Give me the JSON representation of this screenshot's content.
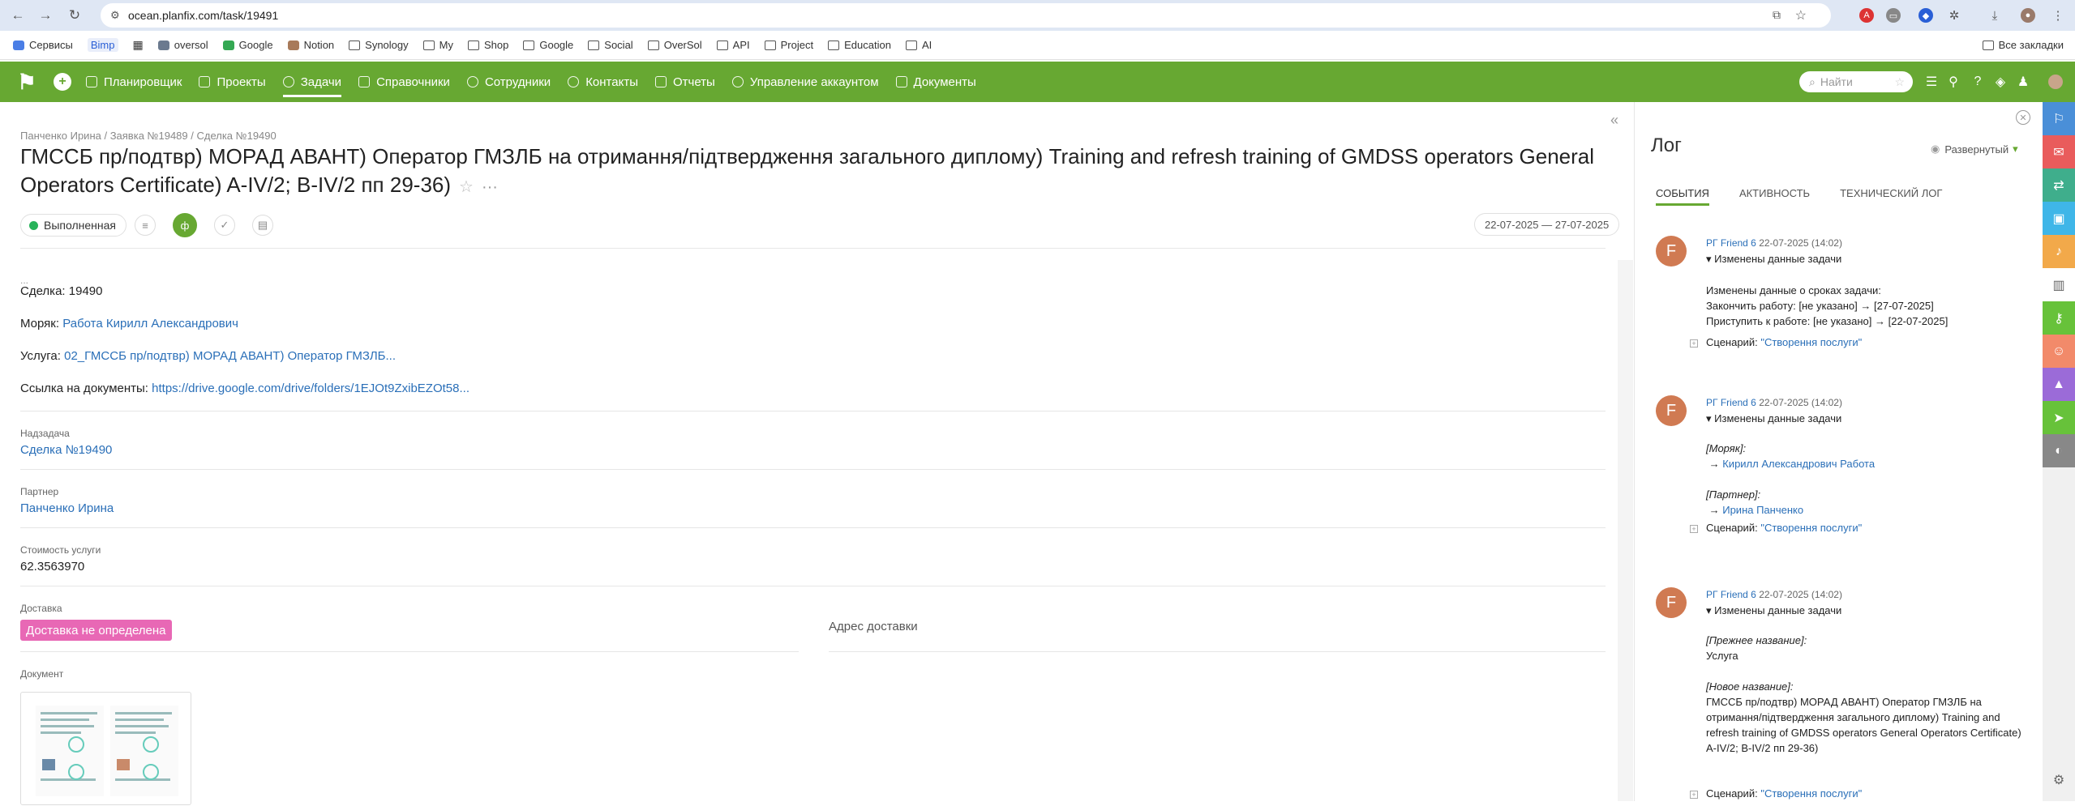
{
  "browser": {
    "url": "ocean.planfix.com/task/19491",
    "bookmarks": [
      "Сервисы",
      "Bimp",
      "",
      "oversol",
      "Google",
      "Notion",
      "Synology",
      "My",
      "Shop",
      "Google",
      "Social",
      "OverSol",
      "API",
      "Project",
      "Education",
      "AI"
    ],
    "all_bookmarks": "Все закладки"
  },
  "appbar": {
    "menu": [
      "Планировщик",
      "Проекты",
      "Задачи",
      "Справочники",
      "Сотрудники",
      "Контакты",
      "Отчеты",
      "Управление аккаунтом",
      "Документы"
    ],
    "active_index": 2,
    "search_placeholder": "Найти",
    "accent": "#67a832"
  },
  "task": {
    "breadcrumb": "Панченко Ирина / Заявка №19489 / Сделка №19490",
    "title": "ГМССБ пр/подтвр) МОРАД АВАНТ) Оператор ГМЗЛБ на отримання/підтвердження загального диплому) Training and refresh training of GMDSS operators General Operators Certificate) A-IV/2; B-IV/2 пп 29-36)",
    "status": "Выполненная",
    "status_color": "#27b35a",
    "dates": "22-07-2025 — 27-07-2025",
    "dots": "...",
    "deal_label": "Сделка:",
    "deal_value": "19490",
    "sailor_label": "Моряк:",
    "sailor_value": "Работа Кирилл Александрович",
    "service_label": "Услуга:",
    "service_value": "02_ГМССБ пр/подтвр) МОРАД АВАНТ) Оператор ГМЗЛБ...",
    "docs_label": "Ссылка на документы:",
    "docs_value": "https://drive.google.com/drive/folders/1EJOt9ZxibEZOt58...",
    "parent_label": "Надзадача",
    "parent_value": "Сделка №19490",
    "partner_label": "Партнер",
    "partner_value": "Панченко Ирина",
    "cost_label": "Стоимость услуги",
    "cost_value": "62.3563970",
    "delivery_label": "Доставка",
    "delivery_value": "Доставка не определена",
    "delivery_color": "#e868b5",
    "address_label": "Адрес доставки",
    "document_label": "Документ"
  },
  "log": {
    "title": "Лог",
    "mode": "Развернутый",
    "tabs": [
      "СОБЫТИЯ",
      "АКТИВНОСТЬ",
      "ТЕХНИЧЕСКИЙ ЛОГ"
    ],
    "entries": [
      {
        "avatar": "F",
        "author": "РГ Friend 6",
        "time": "22-07-2025 (14:02)",
        "change": "Изменены данные задачи",
        "lines": [
          "Изменены данные о сроках задачи:",
          "Закончить работу: [не указано] → [27-07-2025]",
          "Приступить к работе: [не указано] → [22-07-2025]"
        ],
        "scenario_label": "Сценарий:",
        "scenario": "\"Створення послуги\""
      },
      {
        "avatar": "F",
        "author": "РГ Friend 6",
        "time": "22-07-2025 (14:02)",
        "change": "Изменены данные задачи",
        "field1": "[Моряк]:",
        "value1": "Кирилл Александрович Работа",
        "field2": "[Партнер]:",
        "value2": "Ирина Панченко",
        "scenario_label": "Сценарий:",
        "scenario": "\"Створення послуги\""
      },
      {
        "avatar": "F",
        "author": "РГ Friend 6",
        "time": "22-07-2025 (14:02)",
        "change": "Изменены данные задачи",
        "field1": "[Прежнее название]:",
        "value1": "Услуга",
        "field2": "[Новое название]:",
        "value2": "ГМССБ пр/подтвр) МОРАД АВАНТ) Оператор ГМЗЛБ на отримання/підтвердження загального диплому) Training and refresh training of GMDSS operators General Operators Certificate) A-IV/2; B-IV/2 пп 29-36)",
        "scenario_label": "Сценарий:",
        "scenario": "\"Створення послуги\""
      }
    ]
  },
  "rail_colors": [
    "#4a8fd8",
    "#e95c5c",
    "#3fae8c",
    "#3fb6e8",
    "#f2a94a",
    "#ffffff",
    "#67c23a",
    "#f28a6a",
    "#9b6bd8",
    "#67c23a",
    "#888888"
  ]
}
